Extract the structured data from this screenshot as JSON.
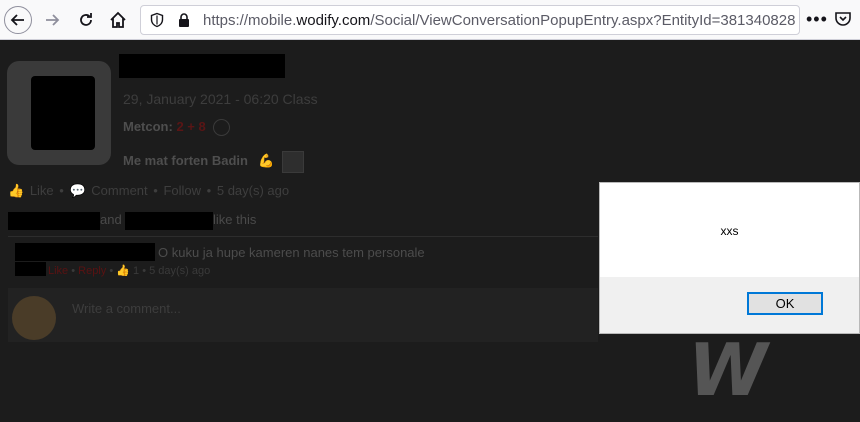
{
  "browser": {
    "url_prefix": "https://mobile.",
    "url_host": "wodify.com",
    "url_path": "/Social/ViewConversationPopupEntry.aspx?EntityId=381340828&E",
    "more_label": "•••"
  },
  "post": {
    "date": "29, January 2021 - 06:20 Class",
    "metcon_label": "Metcon:",
    "metcon_score": "2 + 8",
    "message": "Me mat forten Badin",
    "message_emoji": "💪"
  },
  "actions": {
    "like": "Like",
    "sep1": "•",
    "comment": "Comment",
    "sep2": "•",
    "follow": "Follow",
    "sep3": "•",
    "time": "5 day(s) ago"
  },
  "likes": {
    "and": "and",
    "like_this": "like this"
  },
  "comment": {
    "text": "O kuku ja hupe kameren nanes tem personale",
    "like": "Like",
    "reply": "Reply",
    "count": "1",
    "time": "5 day(s) ago"
  },
  "composer": {
    "placeholder": "Write a comment..."
  },
  "watermark": "W",
  "alert": {
    "message": "xxs",
    "ok_label": "OK"
  }
}
